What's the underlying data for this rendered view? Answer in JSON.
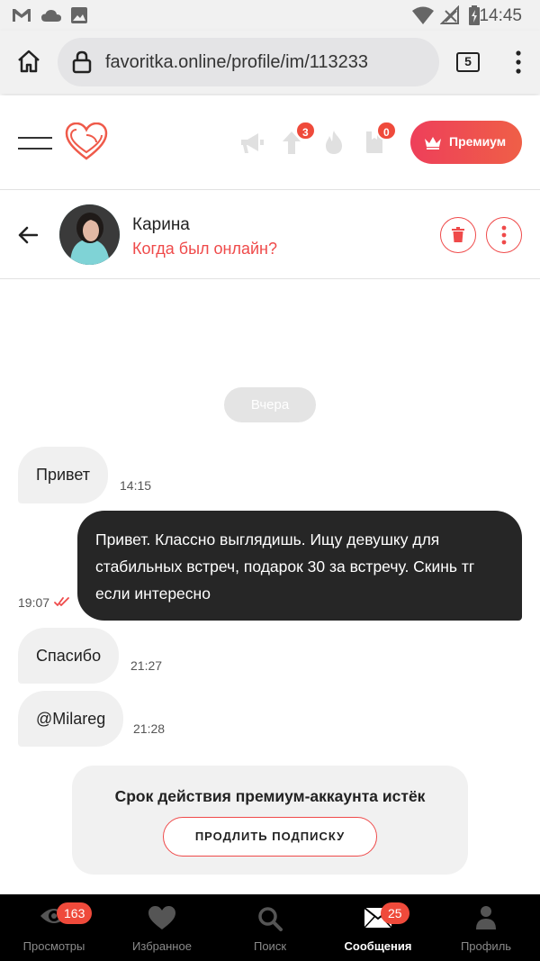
{
  "status_bar": {
    "time": "14:45"
  },
  "browser": {
    "url": "favoritka.online/profile/im/113233",
    "tab_count": "5"
  },
  "header": {
    "boost_badge": "3",
    "book_badge": "0",
    "premium_label": "Премиум"
  },
  "chat": {
    "name": "Карина",
    "status": "Когда был онлайн?",
    "date_divider": "Вчера",
    "messages": [
      {
        "direction": "in",
        "text": "Привет",
        "time": "14:15"
      },
      {
        "direction": "out",
        "lines": [
          "Привет. Классно выглядишь. Ищу девушку для",
          "стабильных встреч, подарок 30 за встречу. Скинь тг",
          "если интересно"
        ],
        "time": "19:07"
      },
      {
        "direction": "in",
        "text": "Спасибо",
        "time": "21:27"
      },
      {
        "direction": "in",
        "text": "@Milareg",
        "time": "21:28"
      }
    ]
  },
  "premium_notice": {
    "text": "Срок действия премиум-аккаунта истёк",
    "button": "ПРОДЛИТЬ ПОДПИСКУ"
  },
  "bottom_nav": [
    {
      "label": "Просмотры",
      "icon": "eye-icon",
      "badge": "163"
    },
    {
      "label": "Избранное",
      "icon": "heart-icon"
    },
    {
      "label": "Поиск",
      "icon": "search-icon"
    },
    {
      "label": "Сообщения",
      "icon": "envelope-icon",
      "badge": "25",
      "active": true
    },
    {
      "label": "Профиль",
      "icon": "person-icon"
    }
  ],
  "colors": {
    "accent": "#ef4a4a",
    "premium_gradient_start": "#ee3f5a",
    "premium_gradient_end": "#ef5f47",
    "outgoing_bubble": "#262626",
    "incoming_bubble": "#f0f0f0"
  }
}
